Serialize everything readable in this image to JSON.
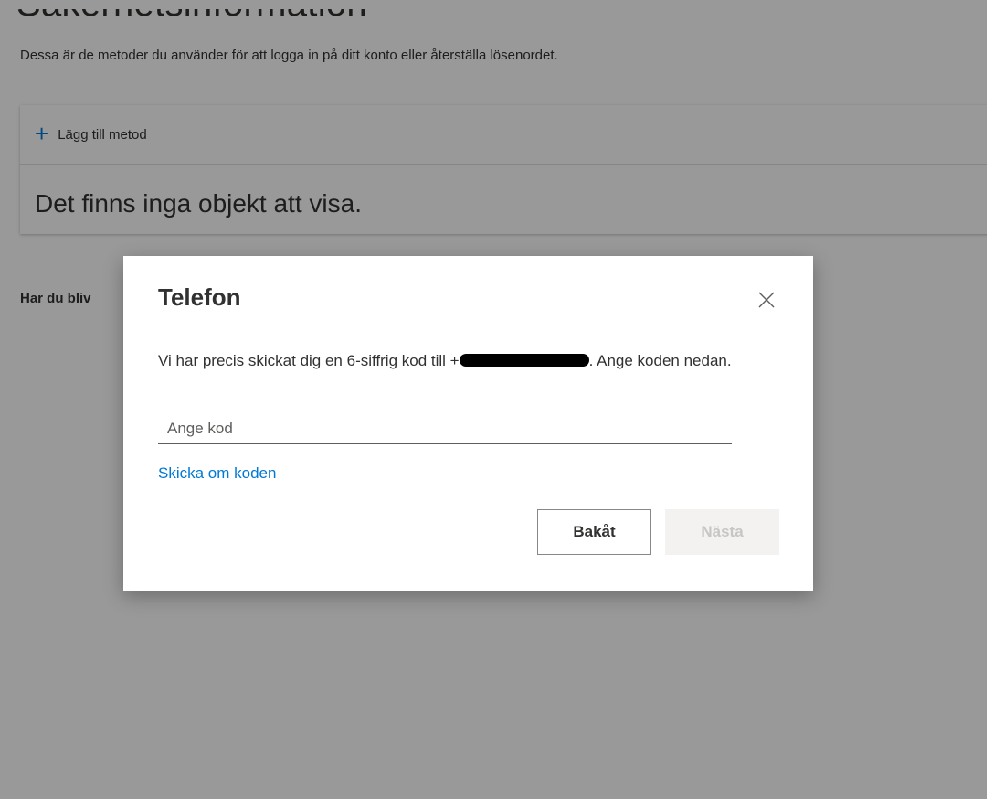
{
  "page": {
    "title": "Säkerhetsinformation",
    "description": "Dessa är de metoder du använder för att logga in på ditt konto eller återställa lösenordet.",
    "add_method_label": "Lägg till metod",
    "empty_text": "Det finns inga objekt att visa.",
    "lost_device_text": "Har du bliv"
  },
  "dialog": {
    "title": "Telefon",
    "message_before": "Vi har precis skickat dig en 6-siffrig kod till +",
    "message_after": ". Ange koden nedan.",
    "input_placeholder": "Ange kod",
    "resend_label": "Skicka om koden",
    "back_label": "Bakåt",
    "next_label": "Nästa"
  },
  "colors": {
    "accent": "#0078d4",
    "text": "#323130",
    "overlay": "rgba(0,0,0,0.4)",
    "disabled_bg": "#f3f2f1",
    "disabled_text": "#c8c6c4"
  },
  "icons": {
    "add": "plus-icon",
    "close": "close-icon"
  }
}
